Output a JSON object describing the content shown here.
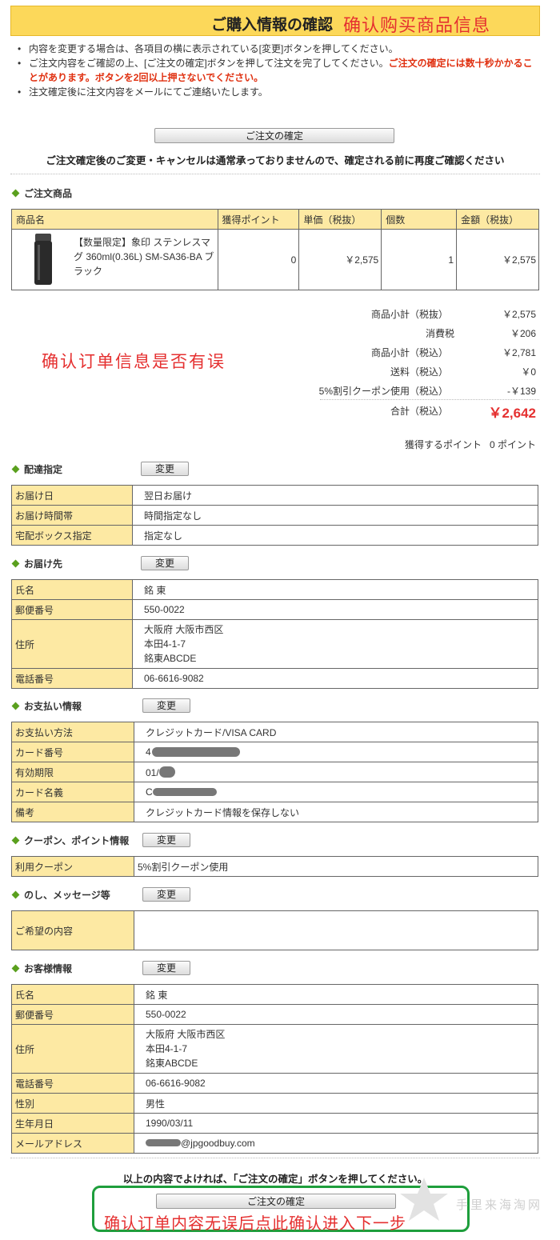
{
  "header": {
    "title_jp": "ご購入情報の確認",
    "title_cn": "确认购买商品信息"
  },
  "notes": {
    "line1": "内容を変更する場合は、各項目の横に表示されている[変更]ボタンを押してください。",
    "line2_a": "ご注文内容をご確認の上、[ご注文の確定]ボタンを押して注文を完了してください。",
    "line2_b": "ご注文の確定には数十秒かかることがあります。ボタンを2回以上押さないでください。",
    "line3": "注文確定後に注文内容をメールにてご連絡いたします。"
  },
  "confirm_button": "ご注文の確定",
  "confirm_note": "ご注文確定後のご変更・キャンセルは通常承っておりませんので、確定される前に再度ご確認ください",
  "change_label": "変更",
  "order_items": {
    "title": "ご注文商品",
    "headers": [
      "商品名",
      "獲得ポイント",
      "単価（税抜）",
      "個数",
      "金額（税抜）"
    ],
    "item": {
      "name": "【数量限定】象印 ステンレスマグ 360ml(0.36L) SM-SA36-BA ブラック",
      "points": "0",
      "unit_price": "￥2,575",
      "qty": "1",
      "amount": "￥2,575"
    }
  },
  "summary": {
    "rows": [
      {
        "label": "商品小計（税抜）",
        "value": "￥2,575"
      },
      {
        "label": "消費税",
        "value": "￥206"
      },
      {
        "label": "商品小計（税込）",
        "value": "￥2,781"
      },
      {
        "label": "送料（税込）",
        "value": "￥0"
      },
      {
        "label": "5%割引クーポン使用（税込）",
        "value": "-￥139"
      }
    ],
    "total_label": "合計（税込）",
    "total_value": "￥2,642",
    "points_label": "獲得するポイント",
    "points_value": "0 ポイント"
  },
  "annotation_check": "确认订单信息是否有误",
  "delivery": {
    "title": "配達指定",
    "rows": [
      {
        "k": "お届け日",
        "v": "翌日お届け"
      },
      {
        "k": "お届け時間帯",
        "v": "時間指定なし"
      },
      {
        "k": "宅配ボックス指定",
        "v": "指定なし"
      }
    ]
  },
  "shipping": {
    "title": "お届け先",
    "name_k": "氏名",
    "name_v": "銘 東",
    "zip_k": "郵便番号",
    "zip_v": "550-0022",
    "addr_k": "住所",
    "addr_1": "大阪府 大阪市西区",
    "addr_2": "本田4-1-7",
    "addr_3": "銘東ABCDE",
    "tel_k": "電話番号",
    "tel_v": "06-6616-9082"
  },
  "payment": {
    "title": "お支払い情報",
    "method_k": "お支払い方法",
    "method_v": "クレジットカード/VISA CARD",
    "card_k": "カード番号",
    "card_v": "4",
    "exp_k": "有効期限",
    "exp_v": "01/",
    "holder_k": "カード名義",
    "holder_v": "C",
    "note_k": "備考",
    "note_v": "クレジットカード情報を保存しない"
  },
  "coupon": {
    "title": "クーポン、ポイント情報",
    "k": "利用クーポン",
    "v": "5%割引クーポン使用"
  },
  "noshi": {
    "title": "のし、メッセージ等",
    "k": "ご希望の内容"
  },
  "customer": {
    "title": "お客様情報",
    "name_k": "氏名",
    "name_v": "銘 東",
    "zip_k": "郵便番号",
    "zip_v": "550-0022",
    "addr_k": "住所",
    "addr_1": "大阪府 大阪市西区",
    "addr_2": "本田4-1-7",
    "addr_3": "銘東ABCDE",
    "tel_k": "電話番号",
    "tel_v": "06-6616-9082",
    "sex_k": "性別",
    "sex_v": "男性",
    "birth_k": "生年月日",
    "birth_v": "1990/03/11",
    "mail_k": "メールアドレス",
    "mail_v": "@jpgoodbuy.com"
  },
  "final_note": "以上の内容でよければ、「ご注文の確定」ボタンを押してください。",
  "annotation_final": "确认订单内容无误后点此确认进入下一步",
  "watermark": "手里来海淘网",
  "colors": {
    "accent_red": "#e53030",
    "header_yellow": "#fcd85a",
    "cell_yellow": "#fde9a3",
    "green": "#1e9e3c"
  }
}
